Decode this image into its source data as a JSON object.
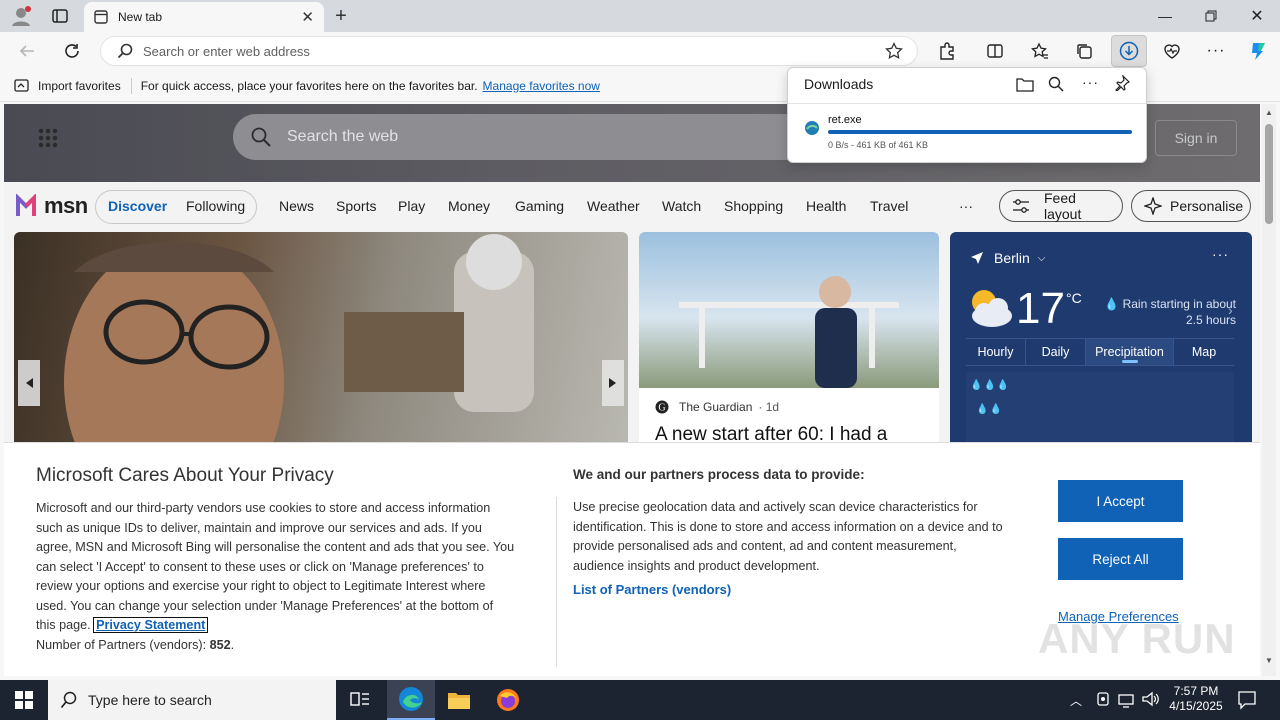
{
  "browser": {
    "tab_title": "New tab",
    "address_placeholder": "Search or enter web address"
  },
  "favbar": {
    "import_label": "Import favorites",
    "hint": "For quick access, place your favorites here on the favorites bar.",
    "manage_link": "Manage favorites now"
  },
  "downloads": {
    "title": "Downloads",
    "file_name": "ret.exe",
    "status": "0 B/s - 461 KB of 461 KB",
    "progress_percent": 100
  },
  "msn": {
    "search_placeholder": "Search the web",
    "sign_in": "Sign in",
    "logo_text": "msn",
    "tabs": [
      "Discover",
      "Following"
    ],
    "nav": [
      "News",
      "Sports",
      "Play",
      "Money",
      "Gaming",
      "Weather",
      "Watch",
      "Shopping",
      "Health",
      "Travel"
    ],
    "more": "···",
    "feed_layout": "Feed layout",
    "personalise": "Personalise",
    "story_source": "The Guardian",
    "story_age": "· 1d",
    "story_headline": "A new start after 60: I had a"
  },
  "weather": {
    "city": "Berlin",
    "temp": "17",
    "unit": "°C",
    "desc_line1": "Rain starting in about",
    "desc_line2": "2.5 hours",
    "tabs": [
      "Hourly",
      "Daily",
      "Precipitation",
      "Map"
    ],
    "active_tab": "Precipitation",
    "more": "···"
  },
  "privacy": {
    "title": "Microsoft Cares About Your Privacy",
    "body_lines": [
      "Microsoft and our third-party vendors use cookies to store and access information",
      "such as unique IDs to deliver, maintain and improve our services and ads. If you",
      "agree, MSN and Microsoft Bing will personalise the content and ads that you see. You",
      "can select 'I Accept' to consent to these uses or click on 'Manage preferences' to",
      "review your options and exercise your right to object to Legitimate Interest where",
      "used.  You can change your selection under 'Manage Preferences' at the bottom of"
    ],
    "body_last_prefix": "this page.",
    "privacy_link": "Privacy Statement",
    "partners_label": "Number of Partners (vendors):",
    "partners_count": "852",
    "partners_suffix": ".",
    "right_title": "We and our partners process data to provide:",
    "right_lines": [
      "Use precise geolocation data and actively scan device characteristics for",
      "identification. This is done to store and access information on a device and to",
      "provide personalised ads and content, ad and content measurement,",
      "audience insights and product development."
    ],
    "vendors_link": "List of Partners (vendors)",
    "accept": "I Accept",
    "reject": "Reject All",
    "manage": "Manage Preferences"
  },
  "taskbar": {
    "search_placeholder": "Type here to search",
    "time": "7:57 PM",
    "date": "4/15/2025"
  },
  "watermark": "ANY RUN",
  "colors": {
    "accent": "#0f62b6",
    "weather_bg": "#1e3a6e",
    "taskbar": "#1c2331"
  }
}
